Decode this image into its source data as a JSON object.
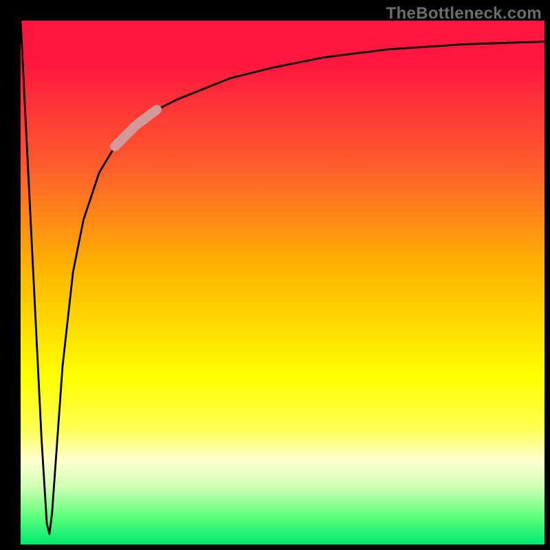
{
  "watermark": "TheBottleneck.com",
  "chart_data": {
    "type": "line",
    "title": "",
    "xlabel": "",
    "ylabel": "",
    "xlim": [
      0,
      100
    ],
    "ylim": [
      0,
      100
    ],
    "series": [
      {
        "name": "bottleneck-curve",
        "x": [
          0,
          2,
          4,
          5,
          5.5,
          6,
          7,
          8,
          10,
          12,
          15,
          18,
          22,
          26,
          30,
          35,
          40,
          48,
          58,
          70,
          85,
          100
        ],
        "y": [
          100,
          60,
          20,
          4,
          2,
          6,
          20,
          34,
          52,
          62,
          71,
          76,
          80,
          83,
          85,
          87,
          89,
          91,
          93,
          94.5,
          95.5,
          96
        ]
      }
    ],
    "highlight_segment": {
      "series": "bottleneck-curve",
      "x_start": 18,
      "x_end": 26
    },
    "background_gradient": {
      "top": "#ff173e",
      "mid": "#ffff00",
      "bottom": "#00e86f"
    }
  }
}
